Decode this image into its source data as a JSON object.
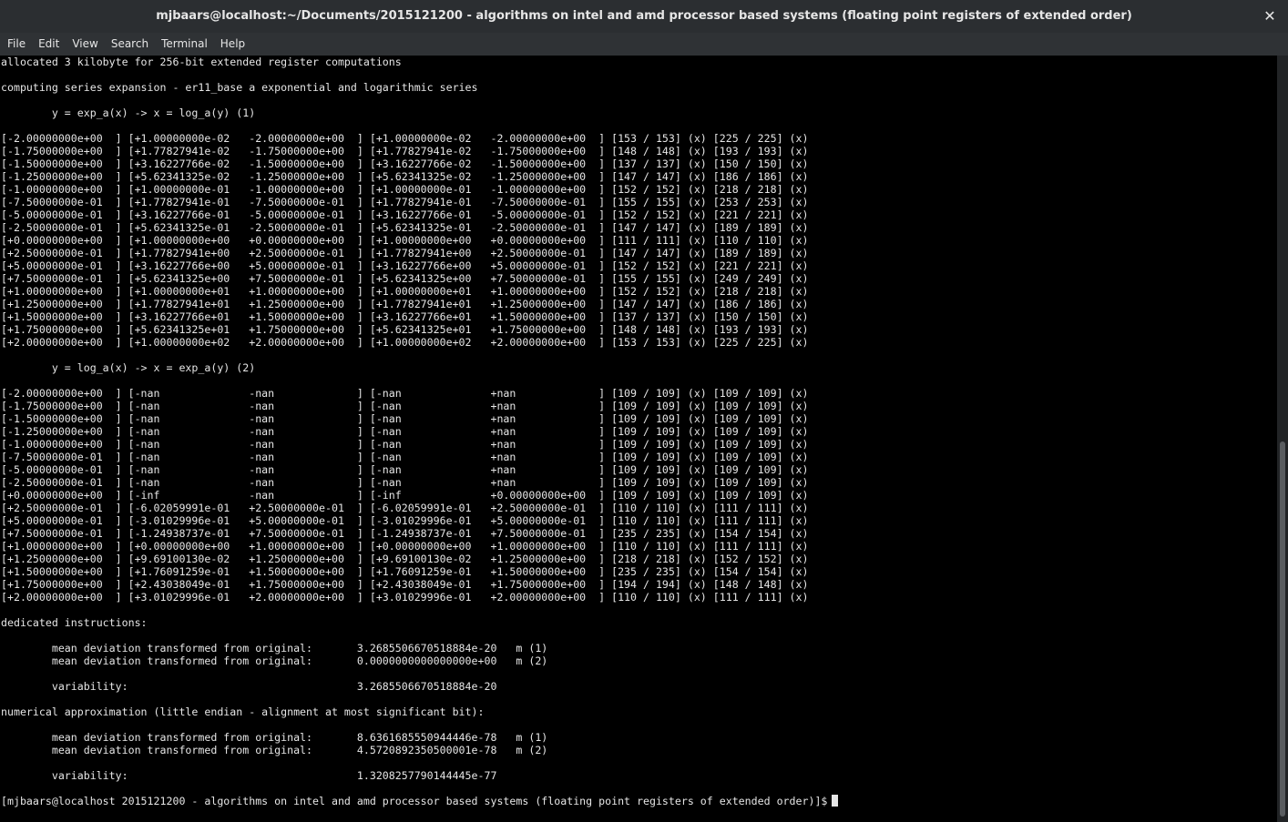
{
  "window": {
    "title": "mjbaars@localhost:~/Documents/2015121200 - algorithms on intel and amd processor based systems (floating point registers of extended order)",
    "close_glyph": "✕"
  },
  "menu": [
    {
      "label": "File"
    },
    {
      "label": "Edit"
    },
    {
      "label": "View"
    },
    {
      "label": "Search"
    },
    {
      "label": "Terminal"
    },
    {
      "label": "Help"
    }
  ],
  "terminal": {
    "output_lines": [
      "allocated 3 kilobyte for 256-bit extended register computations",
      "",
      "computing series expansion - er11_base a exponential and logarithmic series",
      "",
      "        y = exp_a(x) -> x = log_a(y) (1)",
      "",
      "[-2.00000000e+00  ] [+1.00000000e-02   -2.00000000e+00  ] [+1.00000000e-02   -2.00000000e+00  ] [153 / 153] (x) [225 / 225] (x)",
      "[-1.75000000e+00  ] [+1.77827941e-02   -1.75000000e+00  ] [+1.77827941e-02   -1.75000000e+00  ] [148 / 148] (x) [193 / 193] (x)",
      "[-1.50000000e+00  ] [+3.16227766e-02   -1.50000000e+00  ] [+3.16227766e-02   -1.50000000e+00  ] [137 / 137] (x) [150 / 150] (x)",
      "[-1.25000000e+00  ] [+5.62341325e-02   -1.25000000e+00  ] [+5.62341325e-02   -1.25000000e+00  ] [147 / 147] (x) [186 / 186] (x)",
      "[-1.00000000e+00  ] [+1.00000000e-01   -1.00000000e+00  ] [+1.00000000e-01   -1.00000000e+00  ] [152 / 152] (x) [218 / 218] (x)",
      "[-7.50000000e-01  ] [+1.77827941e-01   -7.50000000e-01  ] [+1.77827941e-01   -7.50000000e-01  ] [155 / 155] (x) [253 / 253] (x)",
      "[-5.00000000e-01  ] [+3.16227766e-01   -5.00000000e-01  ] [+3.16227766e-01   -5.00000000e-01  ] [152 / 152] (x) [221 / 221] (x)",
      "[-2.50000000e-01  ] [+5.62341325e-01   -2.50000000e-01  ] [+5.62341325e-01   -2.50000000e-01  ] [147 / 147] (x) [189 / 189] (x)",
      "[+0.00000000e+00  ] [+1.00000000e+00   +0.00000000e+00  ] [+1.00000000e+00   +0.00000000e+00  ] [111 / 111] (x) [110 / 110] (x)",
      "[+2.50000000e-01  ] [+1.77827941e+00   +2.50000000e-01  ] [+1.77827941e+00   +2.50000000e-01  ] [147 / 147] (x) [189 / 189] (x)",
      "[+5.00000000e-01  ] [+3.16227766e+00   +5.00000000e-01  ] [+3.16227766e+00   +5.00000000e-01  ] [152 / 152] (x) [221 / 221] (x)",
      "[+7.50000000e-01  ] [+5.62341325e+00   +7.50000000e-01  ] [+5.62341325e+00   +7.50000000e-01  ] [155 / 155] (x) [249 / 249] (x)",
      "[+1.00000000e+00  ] [+1.00000000e+01   +1.00000000e+00  ] [+1.00000000e+01   +1.00000000e+00  ] [152 / 152] (x) [218 / 218] (x)",
      "[+1.25000000e+00  ] [+1.77827941e+01   +1.25000000e+00  ] [+1.77827941e+01   +1.25000000e+00  ] [147 / 147] (x) [186 / 186] (x)",
      "[+1.50000000e+00  ] [+3.16227766e+01   +1.50000000e+00  ] [+3.16227766e+01   +1.50000000e+00  ] [137 / 137] (x) [150 / 150] (x)",
      "[+1.75000000e+00  ] [+5.62341325e+01   +1.75000000e+00  ] [+5.62341325e+01   +1.75000000e+00  ] [148 / 148] (x) [193 / 193] (x)",
      "[+2.00000000e+00  ] [+1.00000000e+02   +2.00000000e+00  ] [+1.00000000e+02   +2.00000000e+00  ] [153 / 153] (x) [225 / 225] (x)",
      "",
      "        y = log_a(x) -> x = exp_a(y) (2)",
      "",
      "[-2.00000000e+00  ] [-nan              -nan             ] [-nan              +nan             ] [109 / 109] (x) [109 / 109] (x)",
      "[-1.75000000e+00  ] [-nan              -nan             ] [-nan              +nan             ] [109 / 109] (x) [109 / 109] (x)",
      "[-1.50000000e+00  ] [-nan              -nan             ] [-nan              +nan             ] [109 / 109] (x) [109 / 109] (x)",
      "[-1.25000000e+00  ] [-nan              -nan             ] [-nan              +nan             ] [109 / 109] (x) [109 / 109] (x)",
      "[-1.00000000e+00  ] [-nan              -nan             ] [-nan              +nan             ] [109 / 109] (x) [109 / 109] (x)",
      "[-7.50000000e-01  ] [-nan              -nan             ] [-nan              +nan             ] [109 / 109] (x) [109 / 109] (x)",
      "[-5.00000000e-01  ] [-nan              -nan             ] [-nan              +nan             ] [109 / 109] (x) [109 / 109] (x)",
      "[-2.50000000e-01  ] [-nan              -nan             ] [-nan              +nan             ] [109 / 109] (x) [109 / 109] (x)",
      "[+0.00000000e+00  ] [-inf              -nan             ] [-inf              +0.00000000e+00  ] [109 / 109] (x) [109 / 109] (x)",
      "[+2.50000000e-01  ] [-6.02059991e-01   +2.50000000e-01  ] [-6.02059991e-01   +2.50000000e-01  ] [110 / 110] (x) [111 / 111] (x)",
      "[+5.00000000e-01  ] [-3.01029996e-01   +5.00000000e-01  ] [-3.01029996e-01   +5.00000000e-01  ] [110 / 110] (x) [111 / 111] (x)",
      "[+7.50000000e-01  ] [-1.24938737e-01   +7.50000000e-01  ] [-1.24938737e-01   +7.50000000e-01  ] [235 / 235] (x) [154 / 154] (x)",
      "[+1.00000000e+00  ] [+0.00000000e+00   +1.00000000e+00  ] [+0.00000000e+00   +1.00000000e+00  ] [110 / 110] (x) [111 / 111] (x)",
      "[+1.25000000e+00  ] [+9.69100130e-02   +1.25000000e+00  ] [+9.69100130e-02   +1.25000000e+00  ] [218 / 218] (x) [152 / 152] (x)",
      "[+1.50000000e+00  ] [+1.76091259e-01   +1.50000000e+00  ] [+1.76091259e-01   +1.50000000e+00  ] [235 / 235] (x) [154 / 154] (x)",
      "[+1.75000000e+00  ] [+2.43038049e-01   +1.75000000e+00  ] [+2.43038049e-01   +1.75000000e+00  ] [194 / 194] (x) [148 / 148] (x)",
      "[+2.00000000e+00  ] [+3.01029996e-01   +2.00000000e+00  ] [+3.01029996e-01   +2.00000000e+00  ] [110 / 110] (x) [111 / 111] (x)",
      "",
      "dedicated instructions:",
      "",
      "        mean deviation transformed from original:       3.2685506670518884e-20   m (1)",
      "        mean deviation transformed from original:       0.0000000000000000e+00   m (2)",
      "",
      "        variability:                                    3.2685506670518884e-20",
      "",
      "numerical approximation (little endian - alignment at most significant bit):",
      "",
      "        mean deviation transformed from original:       8.6361685550944446e-78   m (1)",
      "        mean deviation transformed from original:       4.5720892350500001e-78   m (2)",
      "",
      "        variability:                                    1.3208257790144445e-77",
      ""
    ],
    "prompt": "[mjbaars@localhost 2015121200 - algorithms on intel and amd processor based systems (floating point registers of extended order)]$"
  },
  "colors": {
    "background": "#000000",
    "text": "#e6e6e6",
    "titlebar": "#2b2e31",
    "menubar": "#2f3235"
  }
}
